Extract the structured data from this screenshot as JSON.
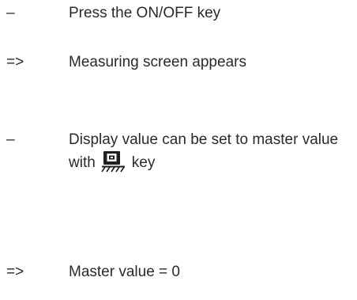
{
  "steps": [
    {
      "marker": "–",
      "text": "Press the ON/OFF key"
    },
    {
      "marker": "=>",
      "text": "Measuring screen appears"
    },
    {
      "marker": "–",
      "text_before": "Display value can be set to master value with",
      "icon": "master-set-key-icon",
      "text_after": "key"
    },
    {
      "marker": "=>",
      "text": "Master value = 0"
    }
  ]
}
